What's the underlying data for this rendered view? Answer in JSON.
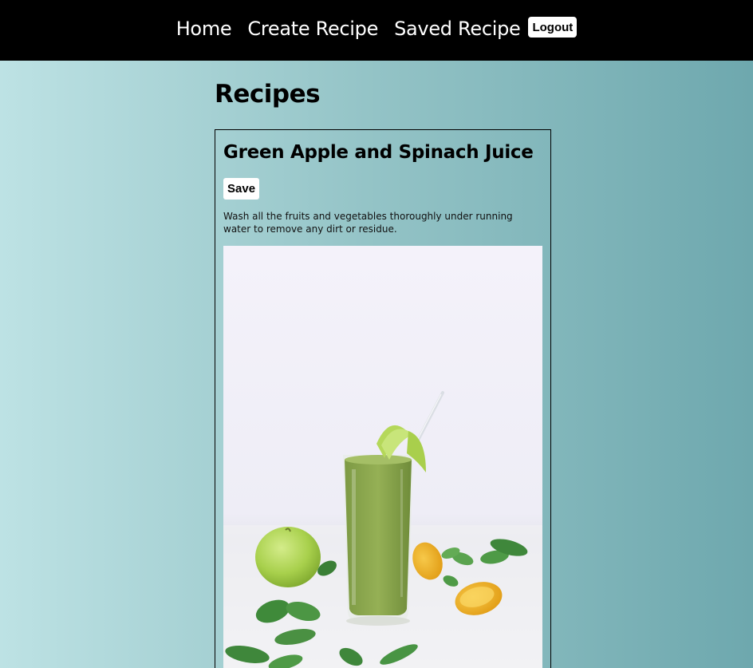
{
  "nav": {
    "links": [
      "Home",
      "Create Recipe",
      "Saved Recipe"
    ],
    "logout_label": "Logout"
  },
  "page": {
    "title": "Recipes"
  },
  "recipes": [
    {
      "name": "Green Apple and Spinach Juice",
      "save_label": "Save",
      "instructions": "Wash all the fruits and vegetables thoroughly under running water to remove any dirt or residue.",
      "image": "green-smoothie-photo"
    }
  ]
}
